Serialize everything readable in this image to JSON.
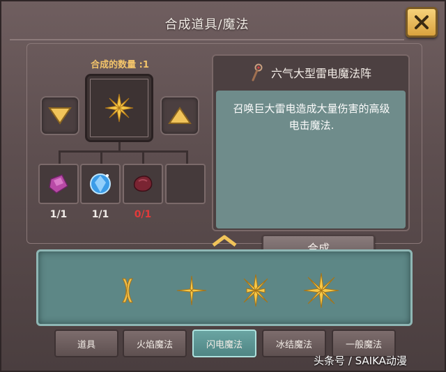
{
  "title": "合成道具/魔法",
  "quantity_label": "合成的数量 :1",
  "selected_item": {
    "name": "六气大型雷电魔法阵",
    "description_line1": "召唤巨大雷电造成大量伤害的高级",
    "description_line2": "电击魔法.",
    "craft_button": "合成"
  },
  "materials": [
    {
      "icon": "purple-crystal-icon",
      "count": "1/1",
      "sufficient": true
    },
    {
      "icon": "blue-gem-icon",
      "count": "1/1",
      "sufficient": true
    },
    {
      "icon": "red-ore-icon",
      "count": "0/1",
      "sufficient": false
    },
    {
      "icon": "empty-slot",
      "count": "",
      "sufficient": true
    }
  ],
  "spells": [
    {
      "icon": "lightning-spell-1-icon"
    },
    {
      "icon": "lightning-spell-2-icon"
    },
    {
      "icon": "lightning-spell-3-icon"
    },
    {
      "icon": "lightning-spell-4-icon"
    }
  ],
  "tabs": [
    {
      "label": "道具",
      "active": false
    },
    {
      "label": "火焰魔法",
      "active": false
    },
    {
      "label": "闪电魔法",
      "active": true
    },
    {
      "label": "冰结魔法",
      "active": false
    },
    {
      "label": "一般魔法",
      "active": false
    }
  ],
  "watermark": "头条号 / SAIKA动漫",
  "colors": {
    "accent_gold": "#f3c46a",
    "insufficient_red": "#e23a3a",
    "teal_panel": "#5d8786",
    "active_tab": "#6aa4a2"
  }
}
